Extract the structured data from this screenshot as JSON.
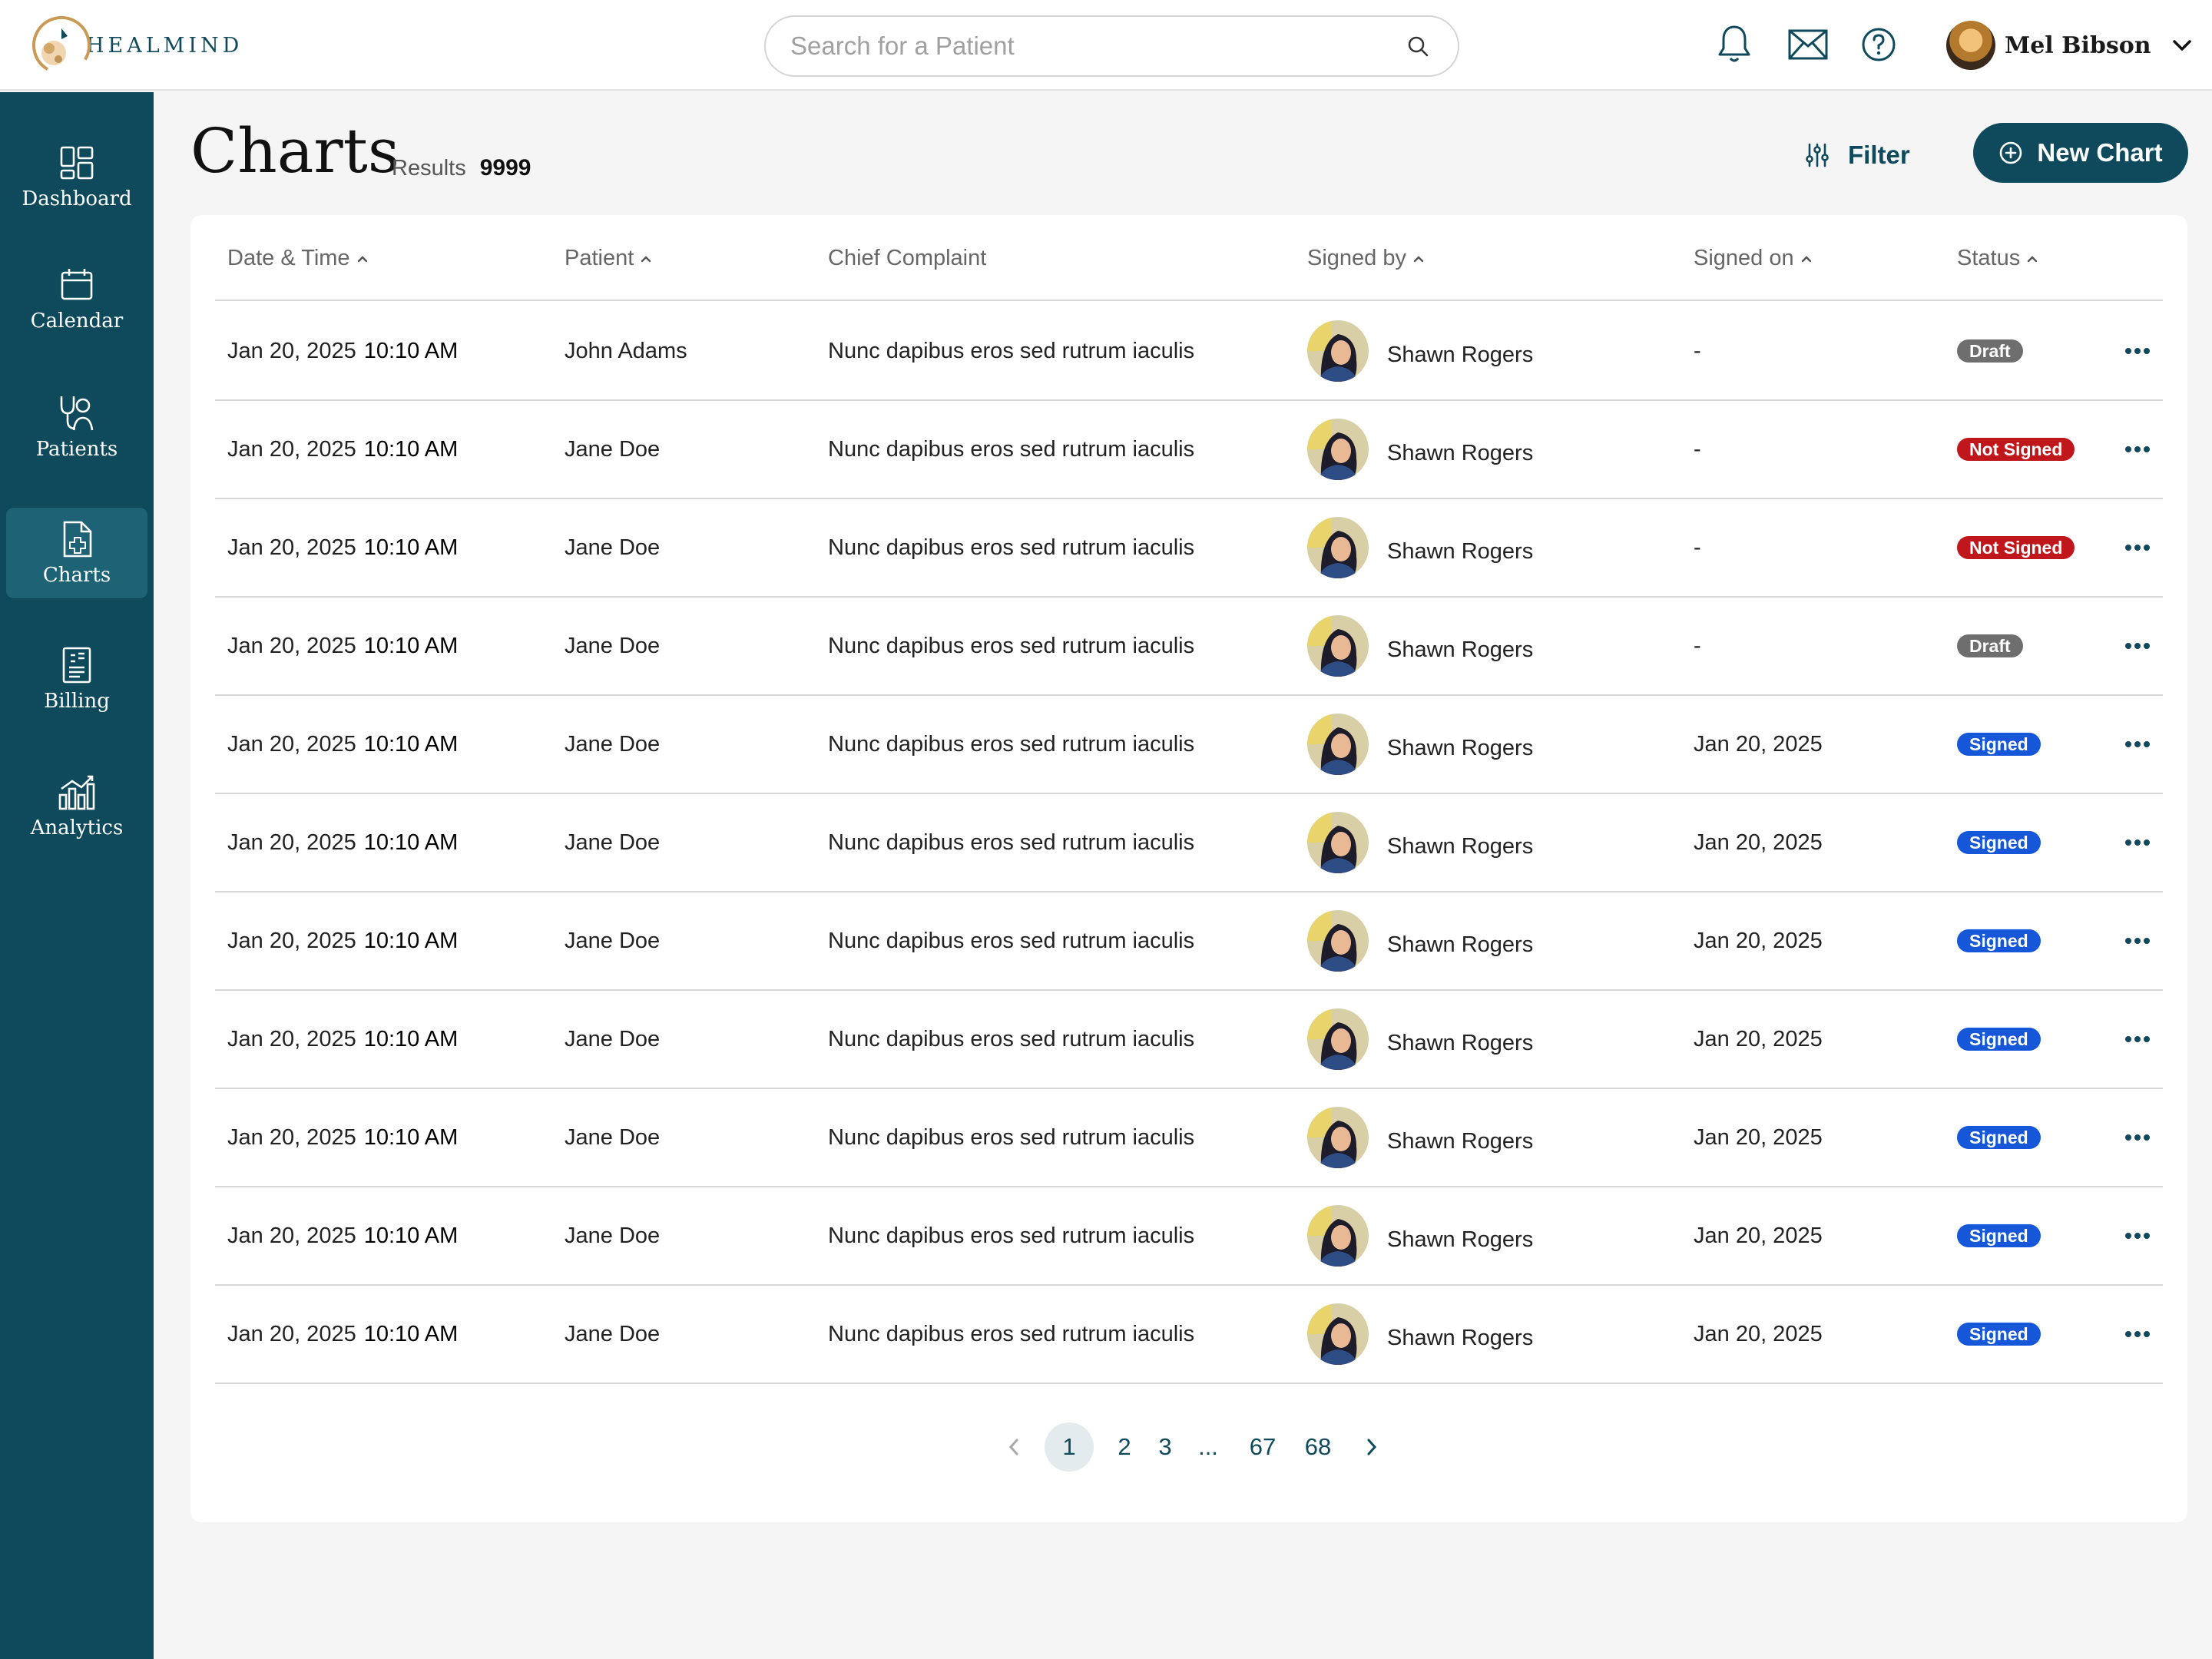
{
  "header": {
    "brand": "HEALMIND",
    "search_placeholder": "Search for a Patient",
    "user_name": "Mel Bibson"
  },
  "sidebar": {
    "items": [
      {
        "label": "Dashboard",
        "icon": "dashboard-icon"
      },
      {
        "label": "Calendar",
        "icon": "calendar-icon"
      },
      {
        "label": "Patients",
        "icon": "patients-icon"
      },
      {
        "label": "Charts",
        "icon": "charts-icon",
        "active": true
      },
      {
        "label": "Billing",
        "icon": "billing-icon"
      },
      {
        "label": "Analytics",
        "icon": "analytics-icon"
      }
    ]
  },
  "page": {
    "title": "Charts",
    "results_label": "Results",
    "results_count": "9999",
    "filter_label": "Filter",
    "new_chart_label": "New Chart"
  },
  "table": {
    "columns": [
      "Date & Time",
      "Patient",
      "Chief Complaint",
      "Signed by",
      "Signed on",
      "Status"
    ],
    "rows": [
      {
        "date": "Jan 20, 2025",
        "time": "10:10 AM",
        "patient": "John Adams",
        "complaint": "Nunc dapibus eros sed rutrum iaculis",
        "signed_by": "Shawn Rogers",
        "signed_on": "-",
        "status": "Draft"
      },
      {
        "date": "Jan 20, 2025",
        "time": "10:10 AM",
        "patient": "Jane Doe",
        "complaint": "Nunc dapibus eros sed rutrum iaculis",
        "signed_by": "Shawn Rogers",
        "signed_on": "-",
        "status": "Not Signed"
      },
      {
        "date": "Jan 20, 2025",
        "time": "10:10 AM",
        "patient": "Jane Doe",
        "complaint": "Nunc dapibus eros sed rutrum iaculis",
        "signed_by": "Shawn Rogers",
        "signed_on": "-",
        "status": "Not Signed"
      },
      {
        "date": "Jan 20, 2025",
        "time": "10:10 AM",
        "patient": "Jane Doe",
        "complaint": "Nunc dapibus eros sed rutrum iaculis",
        "signed_by": "Shawn Rogers",
        "signed_on": "-",
        "status": "Draft"
      },
      {
        "date": "Jan 20, 2025",
        "time": "10:10 AM",
        "patient": "Jane Doe",
        "complaint": "Nunc dapibus eros sed rutrum iaculis",
        "signed_by": "Shawn Rogers",
        "signed_on": "Jan 20, 2025",
        "status": "Signed"
      },
      {
        "date": "Jan 20, 2025",
        "time": "10:10 AM",
        "patient": "Jane Doe",
        "complaint": "Nunc dapibus eros sed rutrum iaculis",
        "signed_by": "Shawn Rogers",
        "signed_on": "Jan 20, 2025",
        "status": "Signed"
      },
      {
        "date": "Jan 20, 2025",
        "time": "10:10 AM",
        "patient": "Jane Doe",
        "complaint": "Nunc dapibus eros sed rutrum iaculis",
        "signed_by": "Shawn Rogers",
        "signed_on": "Jan 20, 2025",
        "status": "Signed"
      },
      {
        "date": "Jan 20, 2025",
        "time": "10:10 AM",
        "patient": "Jane Doe",
        "complaint": "Nunc dapibus eros sed rutrum iaculis",
        "signed_by": "Shawn Rogers",
        "signed_on": "Jan 20, 2025",
        "status": "Signed"
      },
      {
        "date": "Jan 20, 2025",
        "time": "10:10 AM",
        "patient": "Jane Doe",
        "complaint": "Nunc dapibus eros sed rutrum iaculis",
        "signed_by": "Shawn Rogers",
        "signed_on": "Jan 20, 2025",
        "status": "Signed"
      },
      {
        "date": "Jan 20, 2025",
        "time": "10:10 AM",
        "patient": "Jane Doe",
        "complaint": "Nunc dapibus eros sed rutrum iaculis",
        "signed_by": "Shawn Rogers",
        "signed_on": "Jan 20, 2025",
        "status": "Signed"
      },
      {
        "date": "Jan 20, 2025",
        "time": "10:10 AM",
        "patient": "Jane Doe",
        "complaint": "Nunc dapibus eros sed rutrum iaculis",
        "signed_by": "Shawn Rogers",
        "signed_on": "Jan 20, 2025",
        "status": "Signed"
      }
    ]
  },
  "pagination": {
    "pages": [
      "1",
      "2",
      "3",
      "...",
      "67",
      "68"
    ],
    "current": "1"
  },
  "colors": {
    "brand": "#0e4a5c",
    "draft": "#6e6e6e",
    "not_signed": "#c0171d",
    "signed": "#1557d8"
  }
}
